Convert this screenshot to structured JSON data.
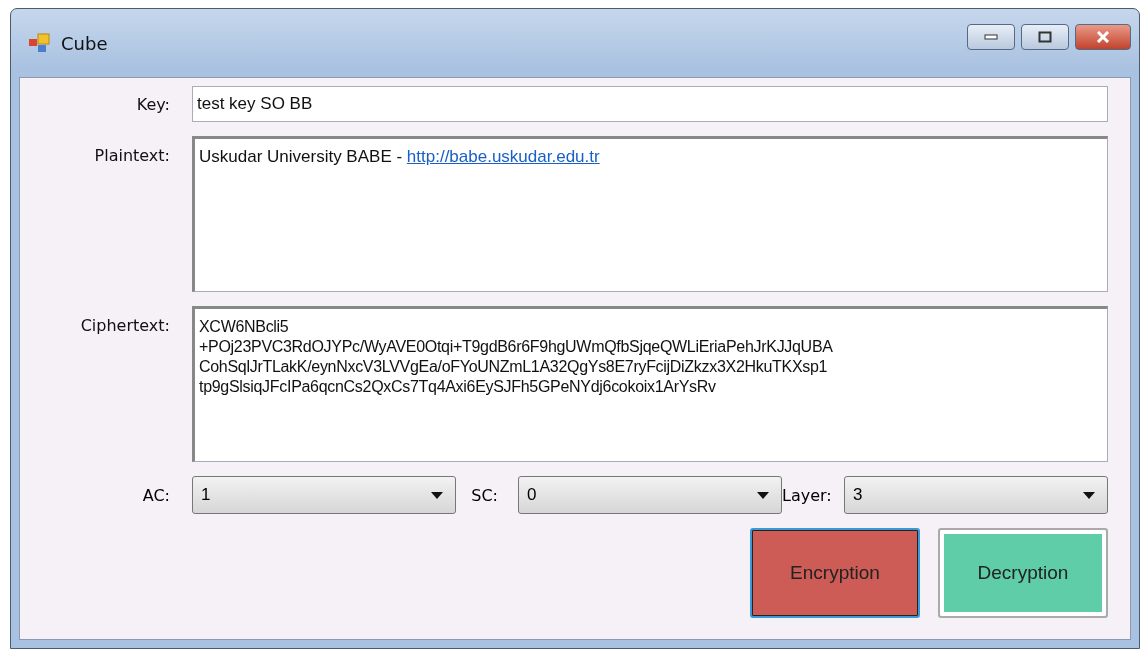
{
  "window": {
    "title": "Cube"
  },
  "key": {
    "label": "Key:",
    "value": "test key SO BB"
  },
  "plaintext": {
    "label": "Plaintext:",
    "text": "Uskudar University BABE - ",
    "link": "http://babe.uskudar.edu.tr"
  },
  "ciphertext": {
    "label": "Ciphertext:",
    "lines": [
      "XCW6NBcli5",
      "+POj23PVC3RdOJYPc/WyAVE0Otqi+T9gdB6r6F9hgUWmQfbSjqeQWLiEriaPehJrKJJqUBA",
      "CohSqlJrTLakK/eynNxcV3LVVgEa/oFYoUNZmL1A32QgYs8E7ryFcijDiZkzx3X2HkuTKXsp1",
      "tp9gSlsiqJFcIPa6qcnCs2QxCs7Tq4Axi6EySJFh5GPeNYdj6cokoix1ArYsRv"
    ]
  },
  "combos": [
    {
      "label": "AC:",
      "value": "1"
    },
    {
      "label": "SC:",
      "value": "0"
    },
    {
      "label": "Layer:",
      "value": "3"
    }
  ],
  "buttons": [
    {
      "label": "Encryption",
      "kind": "encrypt",
      "focused": true
    },
    {
      "label": "Decryption",
      "kind": "decrypt",
      "focused": false
    }
  ]
}
